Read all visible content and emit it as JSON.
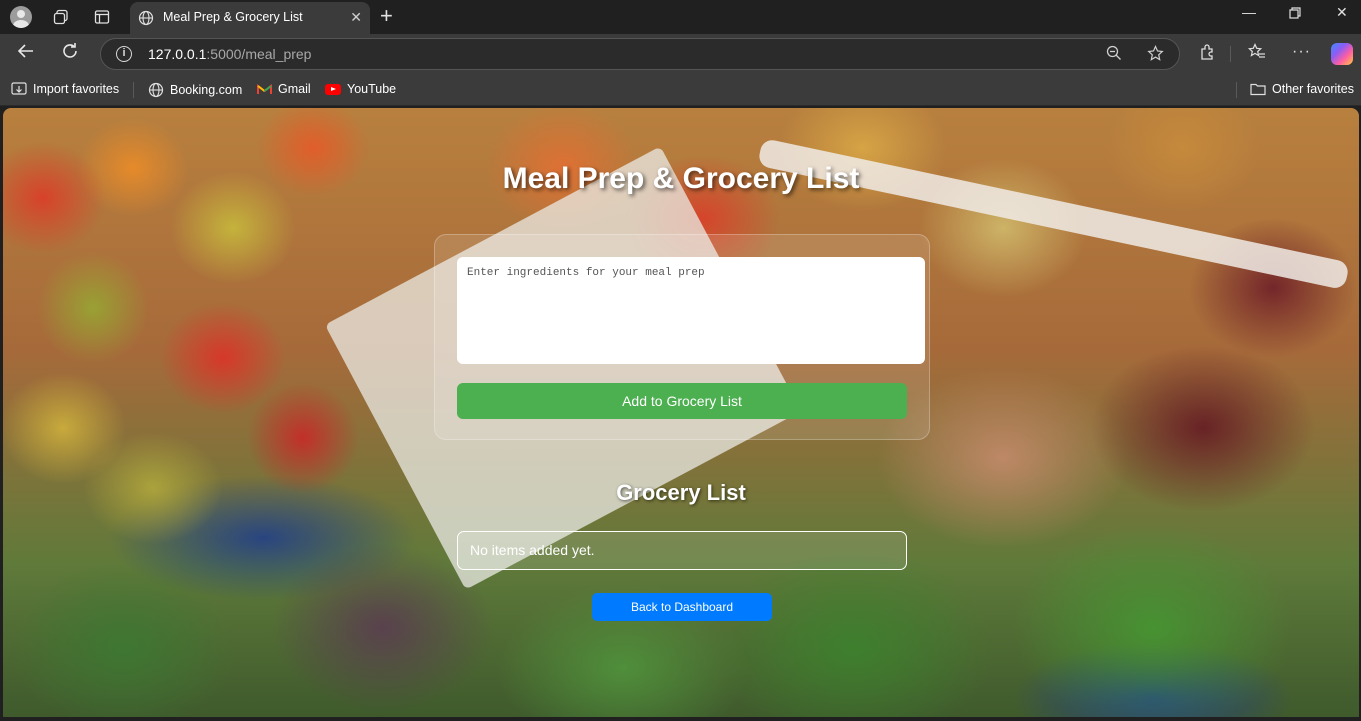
{
  "browser": {
    "tab_title": "Meal Prep & Grocery List",
    "url_host": "127.0.0.1",
    "url_path": ":5000/meal_prep",
    "favorites": [
      {
        "label": "Import favorites",
        "icon": "import-icon"
      },
      {
        "label": "Booking.com",
        "icon": "globe-icon"
      },
      {
        "label": "Gmail",
        "icon": "gmail-icon"
      },
      {
        "label": "YouTube",
        "icon": "youtube-icon"
      }
    ],
    "other_favorites": "Other favorites"
  },
  "page": {
    "title": "Meal Prep & Grocery List",
    "ingredients_placeholder": "Enter ingredients for your meal prep",
    "add_button": "Add to Grocery List",
    "grocery_title": "Grocery List",
    "empty_message": "No items added yet.",
    "back_button": "Back to Dashboard"
  },
  "colors": {
    "add_button": "#4caf50",
    "back_button": "#007bff",
    "browser_chrome": "#3b3b3b"
  }
}
